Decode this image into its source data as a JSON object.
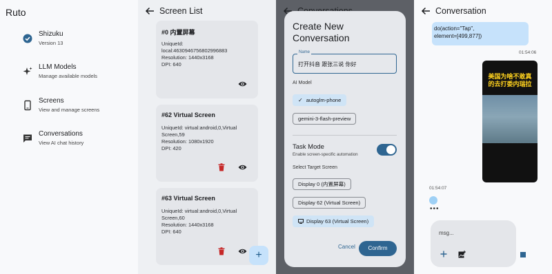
{
  "sidebar": {
    "app_title": "Ruto",
    "items": [
      {
        "title": "Shizuku",
        "subtitle": "Version 13",
        "icon": "check-circle-icon"
      },
      {
        "title": "LLM Models",
        "subtitle": "Manage available models",
        "icon": "sparkle-icon"
      },
      {
        "title": "Screens",
        "subtitle": "View and manage screens",
        "icon": "phone-icon"
      },
      {
        "title": "Conversations",
        "subtitle": "View AI chat history",
        "icon": "chat-icon"
      }
    ]
  },
  "screen_list": {
    "title": "Screen List",
    "cards": [
      {
        "title": "#0 内置屏幕",
        "lines": [
          "UniqueId:",
          "local:4630946756802996883",
          "Resolution: 1440x3168",
          "DPI: 640"
        ]
      },
      {
        "title": "#62 Virtual Screen",
        "lines": [
          "UniqueId: virtual:android,0,Virtual",
          "Screen,59",
          "Resolution: 1080x1920",
          "DPI: 420"
        ]
      },
      {
        "title": "#63 Virtual Screen",
        "lines": [
          "UniqueId: virtual:android,0,Virtual",
          "Screen,60",
          "Resolution: 1440x3168",
          "DPI: 640"
        ]
      }
    ],
    "fab_label": "+"
  },
  "dialog": {
    "behind_title": "Conversations",
    "title": "Create New Conversation",
    "name_label": "Name",
    "name_value": "打开抖音 跟张三说 你好",
    "ai_model_label": "AI Model",
    "models": [
      {
        "label": "autoglm-phone",
        "selected": true
      },
      {
        "label": "gemini-3-flash-preview",
        "selected": false
      }
    ],
    "task_mode_label": "Task Mode",
    "task_mode_desc": "Enable screen-specific automation",
    "task_mode_on": true,
    "target_label": "Select Target Screen",
    "targets": [
      {
        "label": "Display 0 (内置屏幕)",
        "selected": false
      },
      {
        "label": "Display 62 (Virtual Screen)",
        "selected": false
      },
      {
        "label": "Display 63 (Virtual Screen)",
        "selected": true
      }
    ],
    "cancel": "Cancel",
    "confirm": "Confirm"
  },
  "conversation": {
    "title": "Conversation",
    "code_line1": "do(action=\"Tap\",",
    "code_line2": "element=[499,877])",
    "time1": "01:54:06",
    "screenshot_caption": "美国为啥不敢真的去打委内瑞拉",
    "time2": "01:54:07",
    "typing": "•••",
    "input_placeholder": "msg..."
  },
  "colors": {
    "accent": "#2e6591",
    "chip_selected": "#cfe4f6",
    "bubble": "#c6e2fb",
    "delete": "#c62828"
  }
}
